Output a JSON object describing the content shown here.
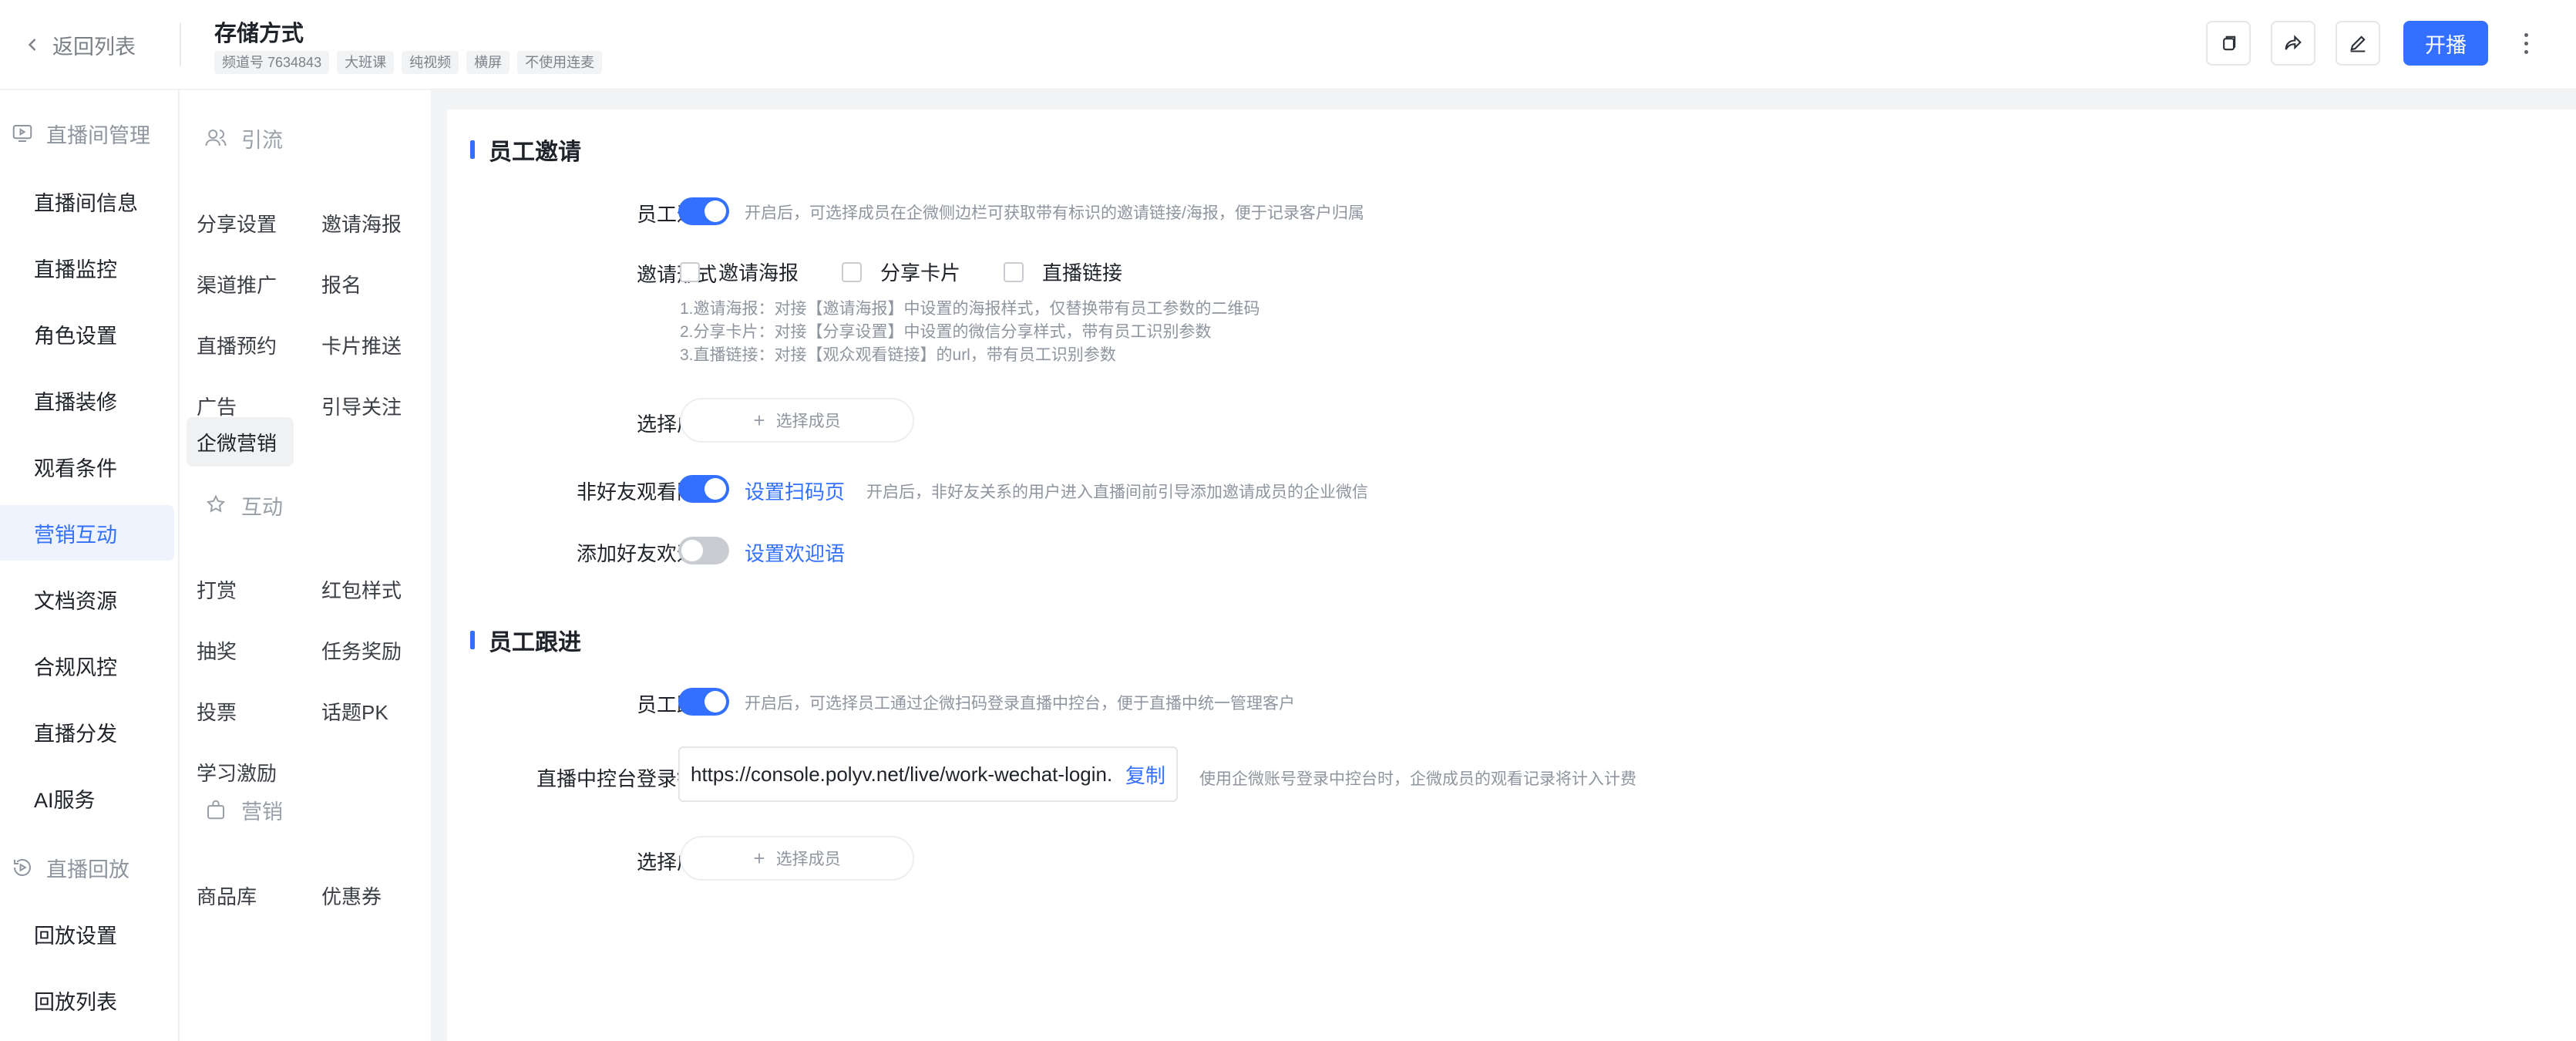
{
  "header": {
    "back_label": "返回列表",
    "title": "存储方式",
    "tags": [
      "频道号 7634843",
      "大班课",
      "纯视频",
      "横屏",
      "不使用连麦"
    ],
    "start_label": "开播"
  },
  "leftnav": {
    "group1": "直播间管理",
    "items1": [
      "直播间信息",
      "直播监控",
      "角色设置",
      "直播装修",
      "观看条件",
      "营销互动",
      "文档资源",
      "合规风控",
      "直播分发",
      "AI服务"
    ],
    "group2": "直播回放",
    "items2": [
      "回放设置",
      "回放列表"
    ]
  },
  "subnav": {
    "group_traffic": "引流",
    "traffic_items": [
      "分享设置",
      "邀请海报",
      "渠道推广",
      "报名",
      "直播预约",
      "卡片推送",
      "广告",
      "引导关注",
      "企微营销"
    ],
    "group_interact": "互动",
    "interact_items": [
      "打赏",
      "红包样式",
      "抽奖",
      "任务奖励",
      "投票",
      "话题PK",
      "学习激励"
    ],
    "group_marketing": "营销",
    "marketing_items": [
      "商品库",
      "优惠券"
    ]
  },
  "main": {
    "invite_section": {
      "title": "员工邀请",
      "invite_label": "员工邀请",
      "invite_hint": "开启后，可选择成员在企微侧边栏可获取带有标识的邀请链接/海报，便于记录客户归属",
      "form_label": "邀请形式",
      "form_options": [
        "邀请海报",
        "分享卡片",
        "直播链接"
      ],
      "form_desc": [
        "1.邀请海报：对接【邀请海报】中设置的海报样式，仅替换带有员工参数的二维码",
        "2.分享卡片：对接【分享设置】中设置的微信分享样式，带有员工识别参数",
        "3.直播链接：对接【观众观看链接】的url，带有员工识别参数"
      ],
      "member_label": "选择成员",
      "member_btn": "选择成员",
      "nonfriend_label": "非好友观看限制",
      "nonfriend_link": "设置扫码页",
      "nonfriend_hint": "开启后，非好友关系的用户进入直播间前引导添加邀请成员的企业微信",
      "welcome_label": "添加好友欢迎语",
      "welcome_link": "设置欢迎语"
    },
    "follow_section": {
      "title": "员工跟进",
      "follow_label": "员工跟进",
      "follow_hint": "开启后，可选择员工通过企微扫码登录直播中控台，便于直播中统一管理客户",
      "console_label": "直播中控台登录链接",
      "console_url": "https://console.polyv.net/live/work-wechat-login.",
      "copy_label": "复制",
      "console_hint": "使用企微账号登录中控台时，企微成员的观看记录将计入计费",
      "member_label": "选择成员",
      "member_btn": "选择成员"
    }
  },
  "state": {
    "invite_switch": true,
    "nonfriend_switch": true,
    "welcome_switch": false,
    "follow_switch": true
  },
  "colors": {
    "accent": "#3370ff",
    "switch_off": "#c9ccd1",
    "nav_active_bg": "#eef3fe"
  }
}
